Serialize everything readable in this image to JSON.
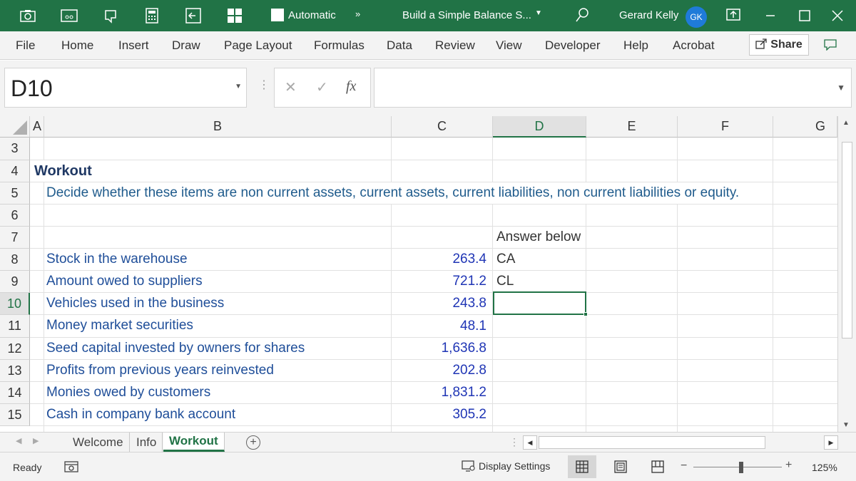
{
  "titlebar": {
    "autosave_label": "Automatic",
    "more_commands": "»",
    "document_title": "Build a Simple Balance S...",
    "user_name": "Gerard Kelly",
    "user_initials": "GK",
    "icons": [
      "camera-icon",
      "accessibility-icon",
      "touch-mode-icon",
      "calculator-icon",
      "exit-icon",
      "apps-grid-icon",
      "search-icon",
      "ribbon-display-icon",
      "minimize-icon",
      "maximize-icon",
      "close-icon"
    ],
    "accent_color": "#217346"
  },
  "ribbon": {
    "tabs": [
      "File",
      "Home",
      "Insert",
      "Draw",
      "Page Layout",
      "Formulas",
      "Data",
      "Review",
      "View",
      "Developer",
      "Help",
      "Acrobat"
    ],
    "share_label": "Share"
  },
  "formula_bar": {
    "name_box": "D10",
    "fx_label": "fx",
    "cancel_symbol": "✕",
    "enter_symbol": "✓",
    "formula_value": ""
  },
  "grid": {
    "columns": [
      "A",
      "B",
      "C",
      "D",
      "E",
      "F",
      "G"
    ],
    "selected_column": "D",
    "rows": [
      "3",
      "4",
      "5",
      "6",
      "7",
      "8",
      "9",
      "10",
      "11",
      "12",
      "13",
      "14",
      "15"
    ],
    "selected_row": "10",
    "active_cell": "D10",
    "title": "Workout",
    "instructions": "Decide whether these items are non current assets, current assets, current liabilities, non current liabilities or equity.",
    "answer_header": "Answer below",
    "items": [
      {
        "row": "8",
        "label": "Stock in the warehouse",
        "value": "263.4",
        "answer": "CA"
      },
      {
        "row": "9",
        "label": "Amount owed to suppliers",
        "value": "721.2",
        "answer": "CL"
      },
      {
        "row": "10",
        "label": "Vehicles used in the business",
        "value": "243.8",
        "answer": ""
      },
      {
        "row": "11",
        "label": "Money market securities",
        "value": "48.1",
        "answer": ""
      },
      {
        "row": "12",
        "label": "Seed capital invested by owners for shares",
        "value": "1,636.8",
        "answer": ""
      },
      {
        "row": "13",
        "label": "Profits from previous years reinvested",
        "value": "202.8",
        "answer": ""
      },
      {
        "row": "14",
        "label": "Monies owed by customers",
        "value": "1,831.2",
        "answer": ""
      },
      {
        "row": "15",
        "label": "Cash in company bank account",
        "value": "305.2",
        "answer": ""
      }
    ]
  },
  "sheets": {
    "tabs": [
      "Welcome",
      "Info",
      "Workout"
    ],
    "active": "Workout",
    "add_label": "+"
  },
  "statusbar": {
    "status": "Ready",
    "display_settings": "Display Settings",
    "zoom": "125%",
    "zoom_minus": "−",
    "zoom_plus": "+"
  }
}
